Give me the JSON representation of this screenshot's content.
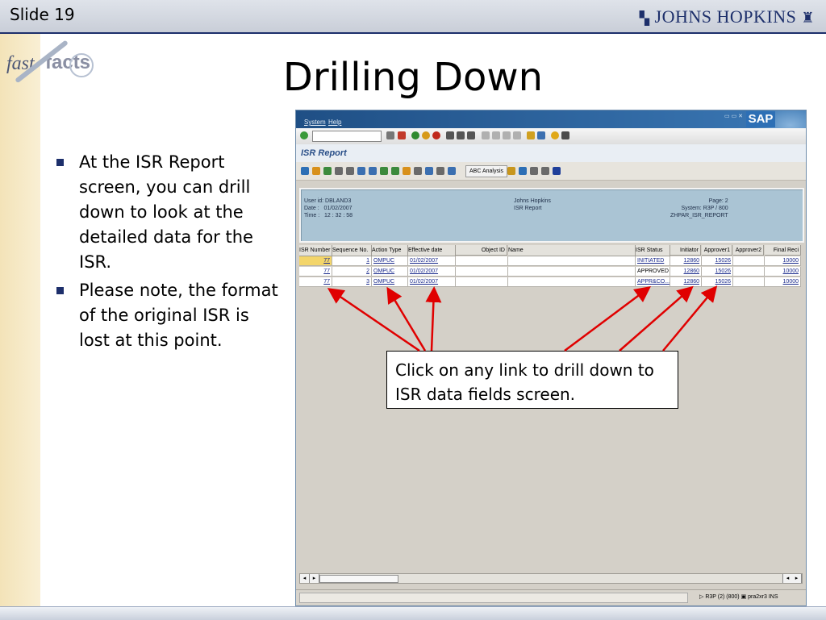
{
  "slide": {
    "label": "Slide 19",
    "brand": "JOHNS HOPKINS",
    "title": "Drilling Down",
    "logo_fast": "fast",
    "logo_facts": "facts",
    "bullets": [
      "At the ISR Report screen, you can drill down to look at the detailed data for the ISR.",
      "Please note, the format of the original ISR is lost at this point."
    ],
    "callout": "Click on any link to drill down to ISR data fields screen.",
    "accent": "#1d2f6b",
    "arrow_color": "#e00000"
  },
  "sap": {
    "menu": {
      "system": "System",
      "help": "Help"
    },
    "logo": "SAP",
    "screen_title": "ISR Report",
    "abc_button": "ABC Analysis",
    "header": {
      "left": "User id: DBLAND3\nDate :   01/02/2007\nTime :   12 : 32 : 58",
      "center": "Johns Hopkins\nISR Report",
      "right": "Page: 2\nSystem: R3P / 800\nZHPAR_ISR_REPORT"
    },
    "columns": [
      "ISR Number",
      "Sequence No.",
      "Action Type",
      "Effective date",
      "Object ID",
      "Name",
      "ISR Status",
      "Initiator",
      "Approver1",
      "Approver2",
      "Final Reci"
    ],
    "rows": [
      [
        "77",
        "1",
        "OMPUC",
        "01/02/2007",
        "",
        "",
        "INITIATED",
        "12860",
        "15026",
        "",
        "10000"
      ],
      [
        "77",
        "2",
        "OMPUC",
        "01/02/2007",
        "",
        "",
        "APPROVED",
        "12860",
        "15026",
        "",
        "10000"
      ],
      [
        "77",
        "3",
        "OMPUC",
        "01/02/2007",
        "",
        "",
        "APPR&CO...",
        "12860",
        "15026",
        "",
        "10000"
      ]
    ],
    "status": {
      "system": "R3P (2) (800)",
      "server": "pra2xr3",
      "mode": "INS"
    }
  }
}
